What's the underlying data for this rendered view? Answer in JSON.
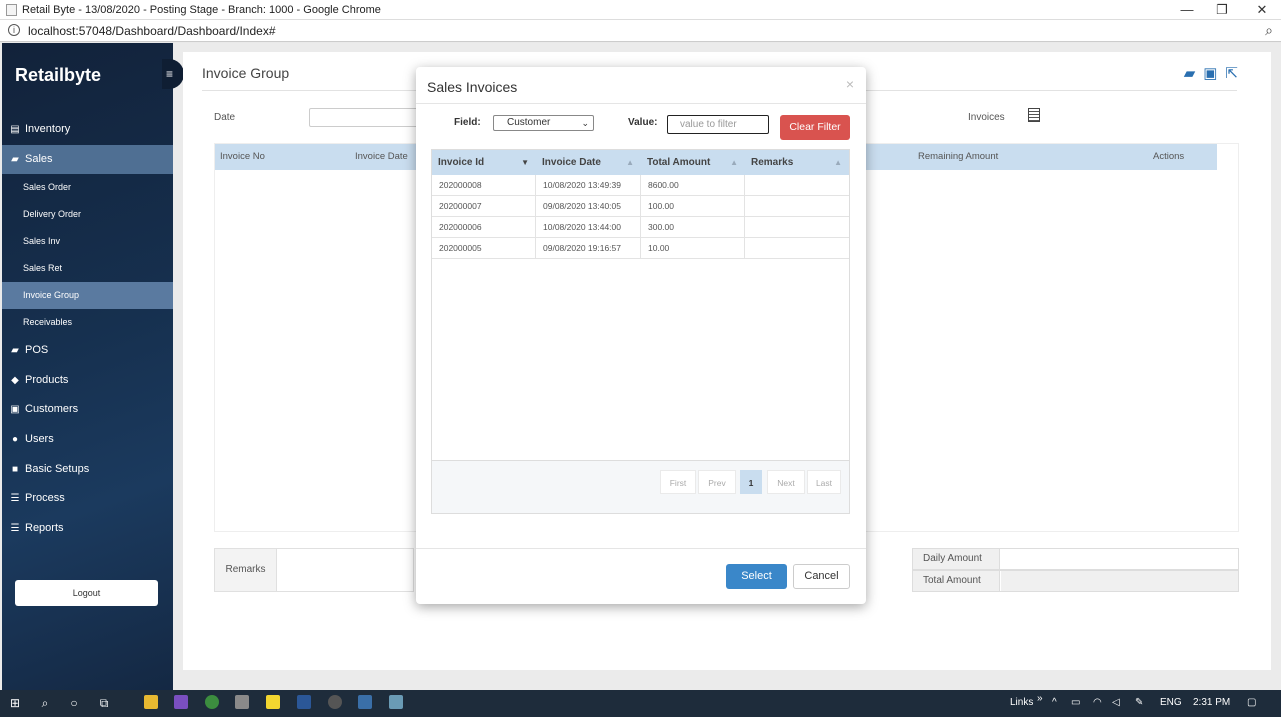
{
  "window": {
    "title": "Retail Byte - 13/08/2020 - Posting Stage - Branch: 1000 - Google Chrome",
    "minimize": "—",
    "restore": "❐",
    "close": "✕"
  },
  "address": {
    "url": "localhost:57048/Dashboard/Dashboard/Index#"
  },
  "sidebar": {
    "brand": "Retailbyte",
    "menu": {
      "inventory": "Inventory",
      "sales": "Sales",
      "sales_order": "Sales Order",
      "delivery_order": "Delivery Order",
      "sales_inv": "Sales Inv",
      "sales_ret": "Sales Ret",
      "invoice_group": "Invoice Group",
      "receivables": "Receivables",
      "pos": "POS",
      "products": "Products",
      "customers": "Customers",
      "users": "Users",
      "basic_setups": "Basic Setups",
      "process": "Process",
      "reports": "Reports"
    },
    "logout": "Logout"
  },
  "main": {
    "page_title": "Invoice Group",
    "date_label": "Date",
    "invoices_label": "Invoices",
    "table_headers": {
      "invoice_no": "Invoice No",
      "invoice_date": "Invoice Date",
      "remaining_amount": "Remaining Amount",
      "actions": "Actions"
    },
    "remarks_label": "Remarks",
    "daily_amount_label": "Daily Amount",
    "total_amount_label": "Total Amount"
  },
  "modal": {
    "title": "Sales Invoices",
    "close": "×",
    "field_label": "Field:",
    "field_value": "Customer",
    "value_label": "Value:",
    "value_placeholder": "value to filter",
    "clear_filter": "Clear Filter",
    "columns": {
      "invoice_id": "Invoice Id",
      "invoice_date": "Invoice Date",
      "total_amount": "Total Amount",
      "remarks": "Remarks"
    },
    "rows": [
      {
        "invoice_id": "202000008",
        "invoice_date": "10/08/2020 13:49:39",
        "total_amount": "8600.00",
        "remarks": ""
      },
      {
        "invoice_id": "202000007",
        "invoice_date": "09/08/2020 13:40:05",
        "total_amount": "100.00",
        "remarks": ""
      },
      {
        "invoice_id": "202000006",
        "invoice_date": "10/08/2020 13:44:00",
        "total_amount": "300.00",
        "remarks": ""
      },
      {
        "invoice_id": "202000005",
        "invoice_date": "09/08/2020 19:16:57",
        "total_amount": "10.00",
        "remarks": ""
      }
    ],
    "pager": {
      "first": "First",
      "prev": "Prev",
      "current": "1",
      "next": "Next",
      "last": "Last"
    },
    "select_button": "Select",
    "cancel_button": "Cancel"
  },
  "taskbar": {
    "links": "Links",
    "language": "ENG",
    "time": "2:31 PM"
  }
}
